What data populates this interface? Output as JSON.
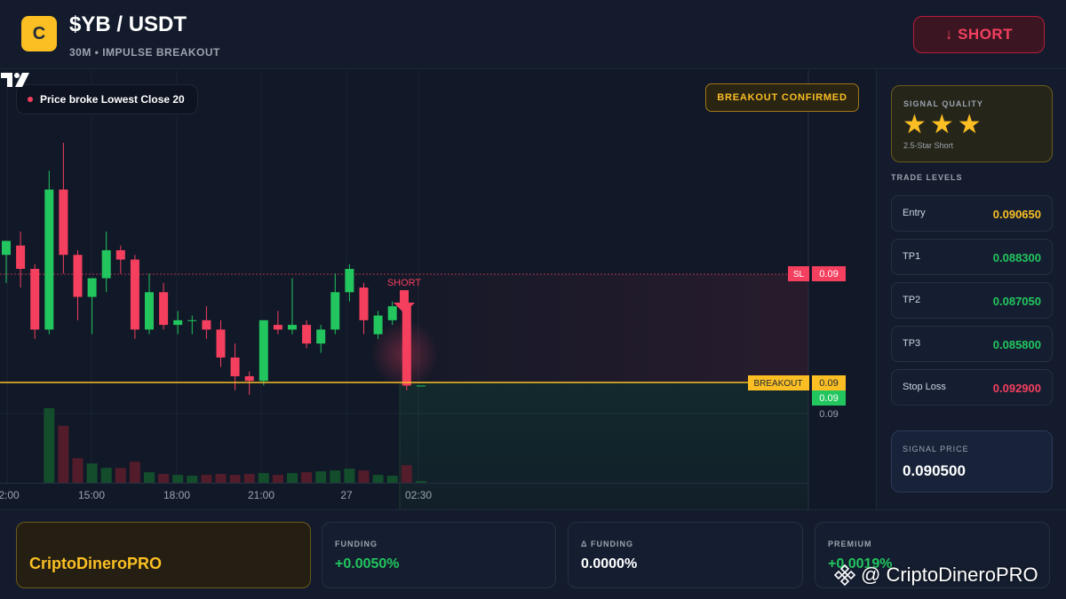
{
  "header": {
    "logo_letter": "C",
    "pair": "$YB / USDT",
    "subtitle": "30M • IMPULSE BREAKOUT",
    "short_button": "↓ SHORT"
  },
  "chart": {
    "note": "Price broke Lowest Close 20",
    "status_badge": "BREAKOUT CONFIRMED",
    "short_marker": "SHORT",
    "sl_tag": "SL",
    "sl_value": "0.09",
    "breakout_tag": "BREAKOUT",
    "breakout_value": "0.09",
    "current_price_tag": "0.09",
    "axis_price": "0.09",
    "time_labels": [
      "2:00",
      "15:00",
      "18:00",
      "21:00",
      "27",
      "02:30"
    ],
    "colors": {
      "bull": "#22c55e",
      "bear": "#f43f5e",
      "breakout": "#fbbf24",
      "sl": "#f43f5e"
    }
  },
  "chart_data": {
    "type": "candlestick",
    "x_tick_labels": [
      "2:00",
      "15:00",
      "18:00",
      "21:00",
      "27",
      "02:30"
    ],
    "horizontal_levels": [
      {
        "label": "SL",
        "value": "0.09"
      },
      {
        "label": "BREAKOUT",
        "value": "0.09"
      }
    ],
    "candles": [
      {
        "o": 0.0894,
        "h": 0.0897,
        "l": 0.0888,
        "c": 0.0897
      },
      {
        "o": 0.0896,
        "h": 0.0899,
        "l": 0.0887,
        "c": 0.0891
      },
      {
        "o": 0.0891,
        "h": 0.0892,
        "l": 0.0876,
        "c": 0.0878
      },
      {
        "o": 0.0878,
        "h": 0.0912,
        "l": 0.0877,
        "c": 0.0908
      },
      {
        "o": 0.0908,
        "h": 0.0918,
        "l": 0.089,
        "c": 0.0894
      },
      {
        "o": 0.0894,
        "h": 0.0895,
        "l": 0.088,
        "c": 0.0885
      },
      {
        "o": 0.0885,
        "h": 0.0889,
        "l": 0.0877,
        "c": 0.0889
      },
      {
        "o": 0.0889,
        "h": 0.0899,
        "l": 0.0886,
        "c": 0.0895
      },
      {
        "o": 0.0895,
        "h": 0.0896,
        "l": 0.089,
        "c": 0.0893
      },
      {
        "o": 0.0893,
        "h": 0.0894,
        "l": 0.0876,
        "c": 0.0878
      },
      {
        "o": 0.0878,
        "h": 0.089,
        "l": 0.0877,
        "c": 0.0886
      },
      {
        "o": 0.0886,
        "h": 0.0888,
        "l": 0.0878,
        "c": 0.0879
      },
      {
        "o": 0.0879,
        "h": 0.0882,
        "l": 0.0877,
        "c": 0.088
      },
      {
        "o": 0.088,
        "h": 0.0881,
        "l": 0.0877,
        "c": 0.088
      },
      {
        "o": 0.088,
        "h": 0.0883,
        "l": 0.0876,
        "c": 0.0878
      },
      {
        "o": 0.0878,
        "h": 0.088,
        "l": 0.087,
        "c": 0.0872
      },
      {
        "o": 0.0872,
        "h": 0.0875,
        "l": 0.0865,
        "c": 0.0868
      },
      {
        "o": 0.0868,
        "h": 0.0869,
        "l": 0.0864,
        "c": 0.0867
      },
      {
        "o": 0.0867,
        "h": 0.088,
        "l": 0.0866,
        "c": 0.088
      },
      {
        "o": 0.0879,
        "h": 0.0882,
        "l": 0.0877,
        "c": 0.0878
      },
      {
        "o": 0.0878,
        "h": 0.0889,
        "l": 0.0877,
        "c": 0.0879
      },
      {
        "o": 0.0879,
        "h": 0.088,
        "l": 0.0874,
        "c": 0.0875
      },
      {
        "o": 0.0875,
        "h": 0.0879,
        "l": 0.0873,
        "c": 0.0878
      },
      {
        "o": 0.0878,
        "h": 0.089,
        "l": 0.0877,
        "c": 0.0886
      },
      {
        "o": 0.0886,
        "h": 0.0892,
        "l": 0.0884,
        "c": 0.0891
      },
      {
        "o": 0.0887,
        "h": 0.0888,
        "l": 0.0877,
        "c": 0.088
      },
      {
        "o": 0.0877,
        "h": 0.0882,
        "l": 0.0876,
        "c": 0.0881
      },
      {
        "o": 0.088,
        "h": 0.0884,
        "l": 0.0879,
        "c": 0.0883
      },
      {
        "o": 0.0883,
        "h": 0.0884,
        "l": 0.0865,
        "c": 0.0866
      },
      {
        "o": 0.0866,
        "h": 0.0866,
        "l": 0.0866,
        "c": 0.0866
      }
    ],
    "volume_units": "relative",
    "volumes": [
      0,
      0,
      0,
      85,
      65,
      28,
      22,
      17,
      17,
      24,
      12,
      10,
      9,
      8,
      9,
      10,
      9,
      10,
      11,
      9,
      11,
      12,
      13,
      14,
      16,
      14,
      9,
      8,
      20,
      2
    ]
  },
  "panel": {
    "quality_label": "SIGNAL QUALITY",
    "stars": "★★★",
    "quality_sub": "2.5-Star Short",
    "levels_title": "TRADE LEVELS",
    "levels": [
      {
        "name": "Entry",
        "value": "0.090650",
        "color": "#fbbf24"
      },
      {
        "name": "TP1",
        "value": "0.088300",
        "color": "#22c55e"
      },
      {
        "name": "TP2",
        "value": "0.087050",
        "color": "#22c55e"
      },
      {
        "name": "TP3",
        "value": "0.085800",
        "color": "#22c55e"
      },
      {
        "name": "Stop Loss",
        "value": "0.092900",
        "color": "#f43f5e"
      }
    ],
    "signal_price_label": "SIGNAL PRICE",
    "signal_price": "0.090500"
  },
  "footer": {
    "brand": "CriptoDineroPRO",
    "stats": [
      {
        "label": "FUNDING",
        "value": "+0.0050%",
        "color": "#22c55e"
      },
      {
        "label": "Δ FUNDING",
        "value": "0.0000%",
        "color": "#ffffff"
      },
      {
        "label": "PREMIUM",
        "value": "+0.0019%",
        "color": "#22c55e"
      }
    ],
    "watermark": "@ CriptoDineroPRO"
  }
}
